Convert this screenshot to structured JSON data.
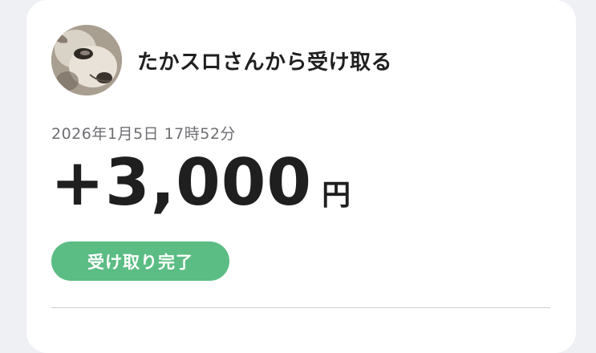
{
  "transaction": {
    "title": "たかスロさんから受け取る",
    "datetime": "2026年1月5日 17時52分",
    "amount": "+3,000",
    "currency": "円",
    "status": "受け取り完了"
  },
  "colors": {
    "status_green": "#5bbd84",
    "text_primary": "#1f1f1f",
    "text_secondary": "#6e6e73",
    "background": "#eef0f4"
  },
  "icons": {
    "avatar": "dog-photo-avatar"
  }
}
